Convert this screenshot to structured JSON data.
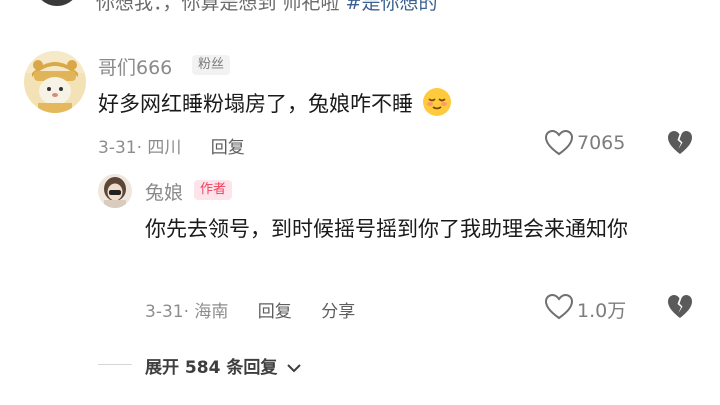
{
  "top_partial": {
    "text": "你想我：，你算是想到 师祀啦",
    "hashtag": "#是你想的"
  },
  "comments": [
    {
      "username": "哥们666",
      "badge": "粉丝",
      "text": "好多网红睡粉塌房了，兔娘咋不睡",
      "emoji": "relieved-face-emoji",
      "date_location": "3-31· 四川",
      "reply_label": "回复",
      "like_count": "7065"
    }
  ],
  "reply": {
    "username": "兔娘",
    "badge": "作者",
    "text": "你先去领号，到时候摇号摇到你了我助理会来通知你",
    "date_location": "3-31· 海南",
    "reply_label": "回复",
    "share_label": "分享",
    "like_count": "1.0万"
  },
  "expand": {
    "label": "展开 584 条回复"
  },
  "colors": {
    "author_badge_bg": "#fde4ea",
    "author_badge_text": "#f0415f",
    "meta_text": "#8d8d8d"
  }
}
